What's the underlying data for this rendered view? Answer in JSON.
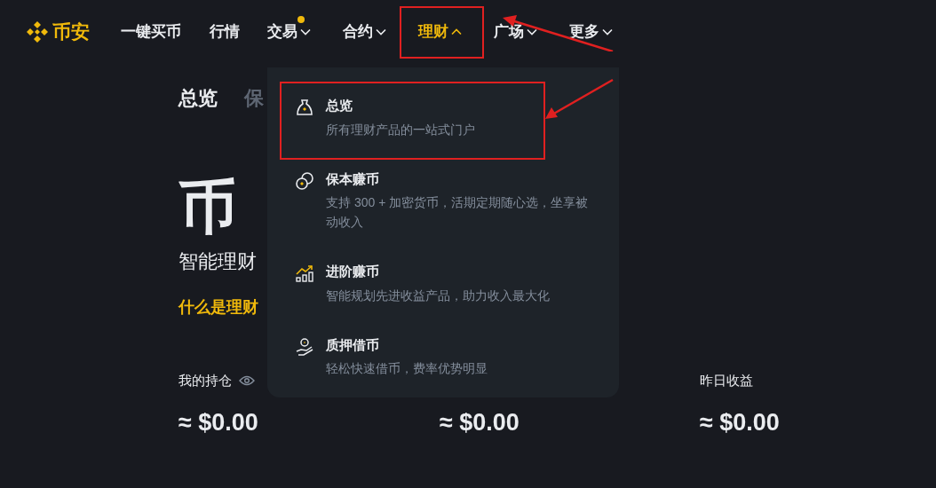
{
  "nav": {
    "logo": "币安",
    "items": [
      {
        "label": "一键买币",
        "selected": false,
        "dropdown": false,
        "dot": false
      },
      {
        "label": "行情",
        "selected": false,
        "dropdown": false,
        "dot": false
      },
      {
        "label": "交易",
        "selected": false,
        "dropdown": true,
        "dot": true
      },
      {
        "label": "合约",
        "selected": false,
        "dropdown": true,
        "dot": false
      },
      {
        "label": "理财",
        "selected": true,
        "dropdown": true,
        "dot": false
      },
      {
        "label": "广场",
        "selected": false,
        "dropdown": true,
        "dot": false
      },
      {
        "label": "更多",
        "selected": false,
        "dropdown": true,
        "dot": false
      }
    ]
  },
  "tabs": [
    {
      "label": "总览",
      "selected": true
    },
    {
      "label": "保",
      "selected": false
    }
  ],
  "hero": {
    "title": "币",
    "subtitle": "智能理财",
    "link": "什么是理财"
  },
  "stats": [
    {
      "label": "我的持仓",
      "eye": true,
      "value": "≈ $0.00"
    },
    {
      "value": "≈ $0.00"
    },
    {
      "label": "昨日收益",
      "eye": false,
      "value": "≈ $0.00"
    }
  ],
  "menu": {
    "items": [
      {
        "kind": "bag",
        "title": "总览",
        "description": "所有理财产品的一站式门户"
      },
      {
        "kind": "coins",
        "title": "保本赚币",
        "description": "支持 300 + 加密货币，活期定期随心选，坐享被动收入"
      },
      {
        "kind": "chart",
        "title": "进阶赚币",
        "description": "智能规划先进收益产品，助力收入最大化"
      },
      {
        "kind": "hand",
        "title": "质押借币",
        "description": "轻松快速借币，费率优势明显"
      }
    ]
  }
}
